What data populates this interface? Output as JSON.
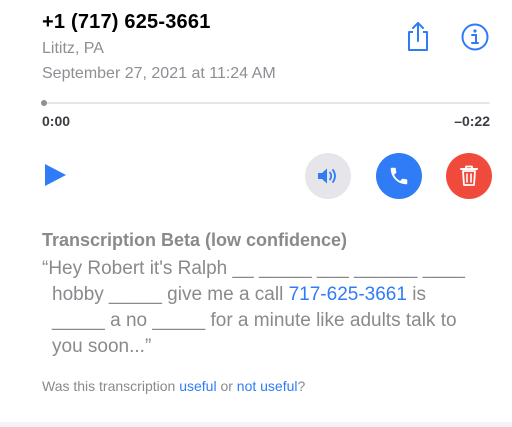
{
  "voicemail": {
    "caller": "+1 (717) 625-3661",
    "location": "Lititz, PA",
    "datetime": "September 27, 2021 at 11:24 AM"
  },
  "player": {
    "elapsed": "0:00",
    "remaining": "–0:22",
    "progress": 0
  },
  "actions": {
    "share_icon": "share-icon",
    "info_icon": "info-icon",
    "play_icon": "play-icon",
    "speaker_icon": "speaker-icon",
    "call_icon": "phone-icon",
    "delete_icon": "trash-icon"
  },
  "transcription": {
    "heading": "Transcription Beta (low confidence)",
    "line1": "“Hey Robert it's Ralph __ _____ ___ ______ ____",
    "line2_before": "hobby _____ give me a call ",
    "line2_link": "717-625-3661",
    "line2_after": " is",
    "line3": "_____ a no _____ for a minute like adults talk to",
    "line4": "you soon...”"
  },
  "feedback": {
    "prefix": "Was this transcription ",
    "useful": "useful",
    "or": " or ",
    "not_useful": "not useful",
    "suffix": "?"
  },
  "colors": {
    "accent": "#2f7cf6",
    "call": "#2f7cf6",
    "delete": "#f04a3c",
    "secondary_text": "#8a8a8e"
  }
}
